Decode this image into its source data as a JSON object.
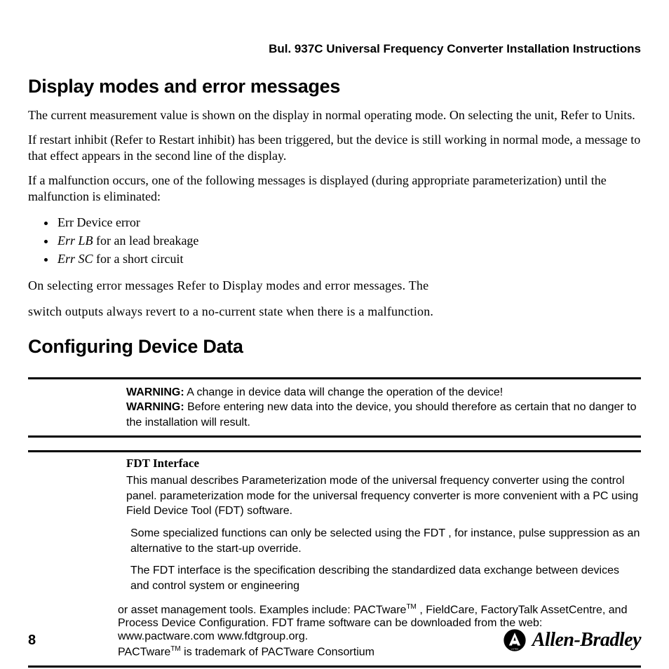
{
  "header": {
    "title": "Bul. 937C Universal Frequency Converter Installation Instructions"
  },
  "section1": {
    "heading": "Display modes and error messages",
    "p1": "The current measurement value is shown on the display in normal operating mode. On selecting the unit, Refer to Units.",
    "p2": "If restart inhibit (Refer to Restart inhibit) has been triggered, but the device is still working in normal mode, a message to that effect appears in the second line of the display.",
    "p3": "If a malfunction occurs, one of the following messages is displayed (during appropriate parameterization) until the malfunction is eliminated:",
    "errs": {
      "e1": "Err Device error",
      "e2_pre": "Err LB",
      "e2_post": " for an lead breakage",
      "e3_pre": "Err SC",
      "e3_post": " for a short circuit"
    },
    "p4a": "On  selecting  error  messages  Refer  to  Display  modes  and  error  messages.  The",
    "p4b": "switch  outputs  always  revert  to  a  no-current  state  when  there  is  a  malfunction."
  },
  "section2": {
    "heading": "Configuring Device Data"
  },
  "warning": {
    "label": "WARNING:",
    "w1": " A change in device data will change the operation of the device!",
    "w2": " Before entering new data into the device, you should therefore as certain that no danger to the installation will result."
  },
  "fdt": {
    "title": "FDT Interface",
    "p1": "This manual describes Parameterization mode of the universal frequency converter using the control panel. parameterization mode for the universal frequency converter is more convenient with a PC using Field Device Tool (FDT) software.",
    "p2": "Some specialized functions can only be selected using the FDT , for instance, pulse suppression as an alternative to the start-up override.",
    "p3": "The FDT interface is the specification describing the standardized data exchange between devices and control system or engineering",
    "p4_a": "or asset management tools. Examples include: PACTware",
    "p4_b": " , FieldCare, FactoryTalk  AssetCentre, and Process Device Configuration. FDT frame software can be downloaded from the web: www.pactware.com www.fdtgroup.org.",
    "p4_c": "PACTware",
    "p4_d": " is trademark of PACTware Consortium",
    "tm": "TM"
  },
  "footer": {
    "page": "8",
    "brand": "Allen-Bradley"
  }
}
